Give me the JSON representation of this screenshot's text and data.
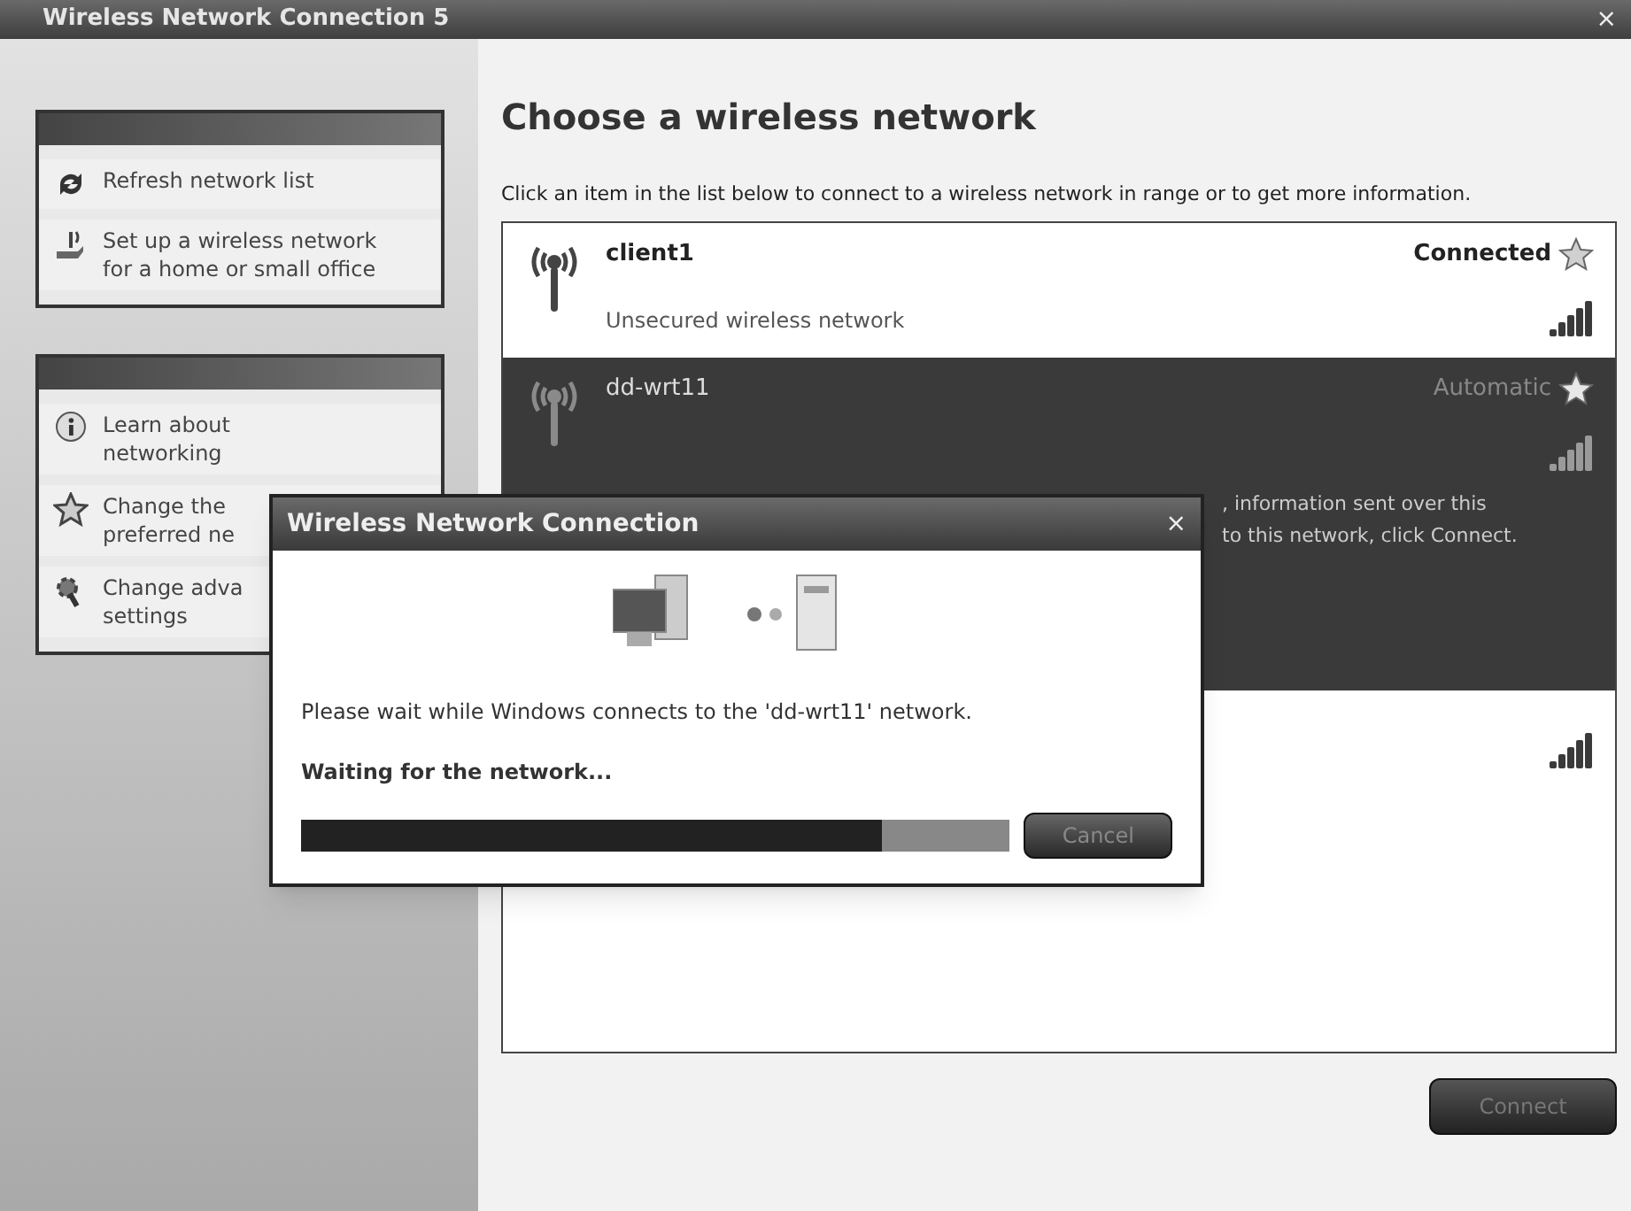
{
  "window": {
    "title": "Wireless Network Connection 5",
    "close": "×"
  },
  "sidebar": {
    "panels": [
      {
        "items": [
          {
            "label": "Refresh network list",
            "kind": "refresh"
          },
          {
            "label": "Set up a wireless network\nfor a home or small office",
            "kind": "setup"
          }
        ]
      },
      {
        "items": [
          {
            "label": "Learn about\nnetworking",
            "kind": "info"
          },
          {
            "label": "Change the\npreferred ne",
            "kind": "star"
          },
          {
            "label": "Change adva\nsettings",
            "kind": "gear"
          }
        ]
      }
    ]
  },
  "heading": "Choose a wireless network",
  "instruction": "Click an item in the list below to connect to a wireless network in range or to get more information.",
  "networks": [
    {
      "name": "client1",
      "status": "Connected",
      "security": "Unsecured wireless network",
      "selected": false
    },
    {
      "name": "dd-wrt11",
      "status": "Automatic",
      "details": [
        ", information sent over this",
        "to this network, click Connect."
      ],
      "selected": true
    },
    {
      "selected": false
    }
  ],
  "connect_button": "Connect",
  "dialog": {
    "title": "Wireless Network Connection",
    "close": "×",
    "message": "Please wait while Windows connects to the 'dd-wrt11' network.",
    "status": "Waiting for the network...",
    "progress": {
      "level": 0.82
    },
    "cancel_button": "Cancel"
  }
}
